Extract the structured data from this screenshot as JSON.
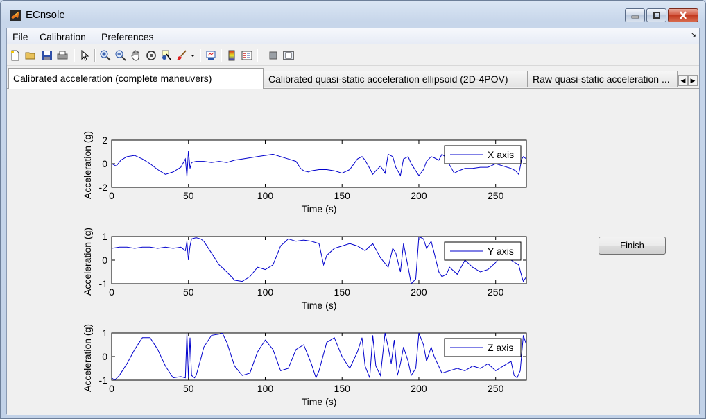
{
  "window": {
    "title": "ECnsole"
  },
  "menu": {
    "items": [
      "File",
      "Calibration",
      "Preferences"
    ]
  },
  "toolbar": {
    "icons": [
      "new-file-icon",
      "open-folder-icon",
      "save-icon",
      "print-icon",
      "pointer-icon",
      "zoom-in-icon",
      "zoom-out-icon",
      "pan-hand-icon",
      "rotate-3d-icon",
      "data-cursor-icon",
      "brush-icon",
      "brush-dropdown-icon",
      "link-plot-icon",
      "colorbar-icon",
      "legend-icon",
      "hide-plot-tools-icon",
      "show-plot-tools-icon"
    ]
  },
  "tabs": [
    {
      "label": "Calibrated acceleration (complete maneuvers)",
      "active": true
    },
    {
      "label": "Calibrated quasi-static acceleration ellipsoid (2D-4POV)",
      "active": false
    },
    {
      "label": "Raw quasi-static acceleration ...",
      "active": false
    }
  ],
  "finish_button": {
    "label": "Finish"
  },
  "colors": {
    "line": "#0000cc",
    "axes": "#000000",
    "background": "#f0f0f0"
  },
  "chart_data": [
    {
      "type": "line",
      "xlabel": "Time (s)",
      "ylabel": "Acceleration (g)",
      "xlim": [
        0,
        270
      ],
      "ylim": [
        -2,
        2
      ],
      "xticks": [
        0,
        50,
        100,
        150,
        200,
        250
      ],
      "yticks": [
        -2,
        0,
        2
      ],
      "legend": "top-right",
      "series": [
        {
          "name": "X axis",
          "x": [
            0,
            3,
            6,
            10,
            15,
            20,
            25,
            30,
            35,
            40,
            45,
            48,
            49,
            50,
            51,
            52,
            55,
            60,
            65,
            70,
            75,
            80,
            85,
            90,
            95,
            100,
            105,
            110,
            115,
            120,
            123,
            125,
            128,
            130,
            135,
            140,
            145,
            150,
            155,
            160,
            163,
            165,
            168,
            170,
            172,
            175,
            178,
            180,
            183,
            185,
            188,
            190,
            193,
            195,
            198,
            200,
            203,
            205,
            208,
            210,
            213,
            215,
            218,
            220,
            223,
            226,
            228,
            230,
            235,
            240,
            245,
            250,
            255,
            260,
            263,
            265,
            267,
            268,
            270
          ],
          "y": [
            0,
            -0.2,
            0.3,
            0.6,
            0.7,
            0.4,
            0,
            -0.5,
            -0.9,
            -0.7,
            -0.3,
            0.4,
            -1.1,
            1.1,
            -0.4,
            0.1,
            0.2,
            0.2,
            0.1,
            0.2,
            0.1,
            0.3,
            0.4,
            0.5,
            0.6,
            0.7,
            0.8,
            0.6,
            0.4,
            0.2,
            -0.4,
            -0.6,
            -0.7,
            -0.6,
            -0.5,
            -0.5,
            -0.6,
            -0.8,
            -0.5,
            0.4,
            0.6,
            0.3,
            -0.4,
            -0.9,
            -0.6,
            -0.2,
            -0.8,
            0.8,
            0.6,
            -0.3,
            -1,
            0.4,
            0.6,
            0,
            -0.6,
            -1,
            -0.5,
            0.2,
            0.6,
            0.5,
            0.3,
            0.8,
            0.5,
            -0.1,
            -0.8,
            -0.6,
            -0.5,
            -0.4,
            -0.4,
            -0.3,
            -0.3,
            0,
            -0.2,
            -0.4,
            -0.6,
            -0.9,
            0.4,
            0.6,
            0.4
          ]
        }
      ]
    },
    {
      "type": "line",
      "xlabel": "Time (s)",
      "ylabel": "Acceleration (g)",
      "xlim": [
        0,
        270
      ],
      "ylim": [
        -1,
        1
      ],
      "xticks": [
        0,
        50,
        100,
        150,
        200,
        250
      ],
      "yticks": [
        -1,
        0,
        1
      ],
      "legend": "top-right",
      "series": [
        {
          "name": "Y axis",
          "x": [
            0,
            5,
            10,
            15,
            20,
            25,
            30,
            35,
            40,
            45,
            48,
            49,
            50,
            51,
            52,
            55,
            58,
            60,
            65,
            70,
            75,
            80,
            85,
            90,
            95,
            100,
            105,
            110,
            115,
            120,
            125,
            130,
            135,
            138,
            140,
            145,
            150,
            155,
            160,
            165,
            170,
            175,
            180,
            183,
            185,
            188,
            190,
            193,
            195,
            198,
            200,
            203,
            205,
            208,
            210,
            213,
            215,
            218,
            220,
            225,
            230,
            235,
            240,
            245,
            250,
            255,
            260,
            265,
            267,
            268,
            270
          ],
          "y": [
            0.5,
            0.55,
            0.55,
            0.5,
            0.55,
            0.55,
            0.5,
            0.55,
            0.5,
            0.55,
            0.4,
            0.8,
            0,
            0.6,
            0.9,
            0.95,
            0.9,
            0.8,
            0.3,
            -0.2,
            -0.5,
            -0.85,
            -0.9,
            -0.7,
            -0.3,
            -0.4,
            -0.2,
            0.6,
            0.9,
            0.8,
            0.85,
            0.8,
            0.7,
            -0.2,
            0.2,
            0.5,
            0.6,
            0.7,
            0.6,
            0.4,
            0.7,
            0.1,
            -0.3,
            0.5,
            0.3,
            -0.5,
            0.7,
            -0.3,
            -1,
            -0.8,
            1,
            0.9,
            0.5,
            0.8,
            0.3,
            -0.5,
            -0.7,
            -0.6,
            -0.3,
            -0.6,
            0,
            -0.3,
            -0.5,
            -0.4,
            -0.1,
            0.3,
            0,
            -0.2,
            -0.7,
            -0.9,
            -0.7
          ]
        }
      ]
    },
    {
      "type": "line",
      "xlabel": "Time (s)",
      "ylabel": "Acceleration (g)",
      "xlim": [
        0,
        270
      ],
      "ylim": [
        -1,
        1
      ],
      "xticks": [
        0,
        50,
        100,
        150,
        200,
        250
      ],
      "yticks": [
        -1,
        0,
        1
      ],
      "legend": "top-right",
      "series": [
        {
          "name": "Z axis",
          "x": [
            0,
            2,
            5,
            10,
            15,
            20,
            25,
            30,
            35,
            40,
            45,
            48,
            49,
            50,
            51,
            52,
            54,
            55,
            58,
            60,
            65,
            70,
            72,
            75,
            80,
            85,
            90,
            95,
            100,
            105,
            110,
            115,
            120,
            125,
            130,
            133,
            135,
            140,
            145,
            150,
            155,
            160,
            163,
            165,
            168,
            170,
            172,
            175,
            178,
            180,
            182,
            184,
            186,
            188,
            190,
            193,
            195,
            198,
            200,
            203,
            205,
            208,
            210,
            215,
            220,
            225,
            230,
            235,
            240,
            245,
            250,
            255,
            260,
            262,
            264,
            266,
            268,
            270
          ],
          "y": [
            -0.9,
            -1,
            -0.8,
            -0.3,
            0.3,
            0.8,
            0.8,
            0.3,
            -0.4,
            -0.9,
            -0.85,
            -0.9,
            1,
            -0.9,
            0.8,
            -0.8,
            -0.9,
            -0.8,
            -0.1,
            0.4,
            0.9,
            0.95,
            1,
            0.6,
            -0.4,
            -0.8,
            -0.7,
            0.2,
            0.7,
            0.3,
            -0.6,
            -0.5,
            0.3,
            0.5,
            -0.3,
            -0.9,
            -0.6,
            0.6,
            0.8,
            0,
            -0.5,
            0.2,
            0.8,
            -0.4,
            -0.9,
            0.9,
            -0.4,
            -0.8,
            1,
            0.4,
            -0.3,
            0.7,
            -0.8,
            -0.3,
            0.4,
            -0.2,
            -0.8,
            -0.5,
            1,
            0.5,
            -0.2,
            0.4,
            0,
            -0.7,
            -0.6,
            -0.5,
            -0.6,
            -0.4,
            -0.5,
            -0.3,
            -0.6,
            -0.4,
            -0.2,
            -0.8,
            -0.9,
            -0.6,
            0.9,
            0.5
          ]
        }
      ]
    }
  ]
}
